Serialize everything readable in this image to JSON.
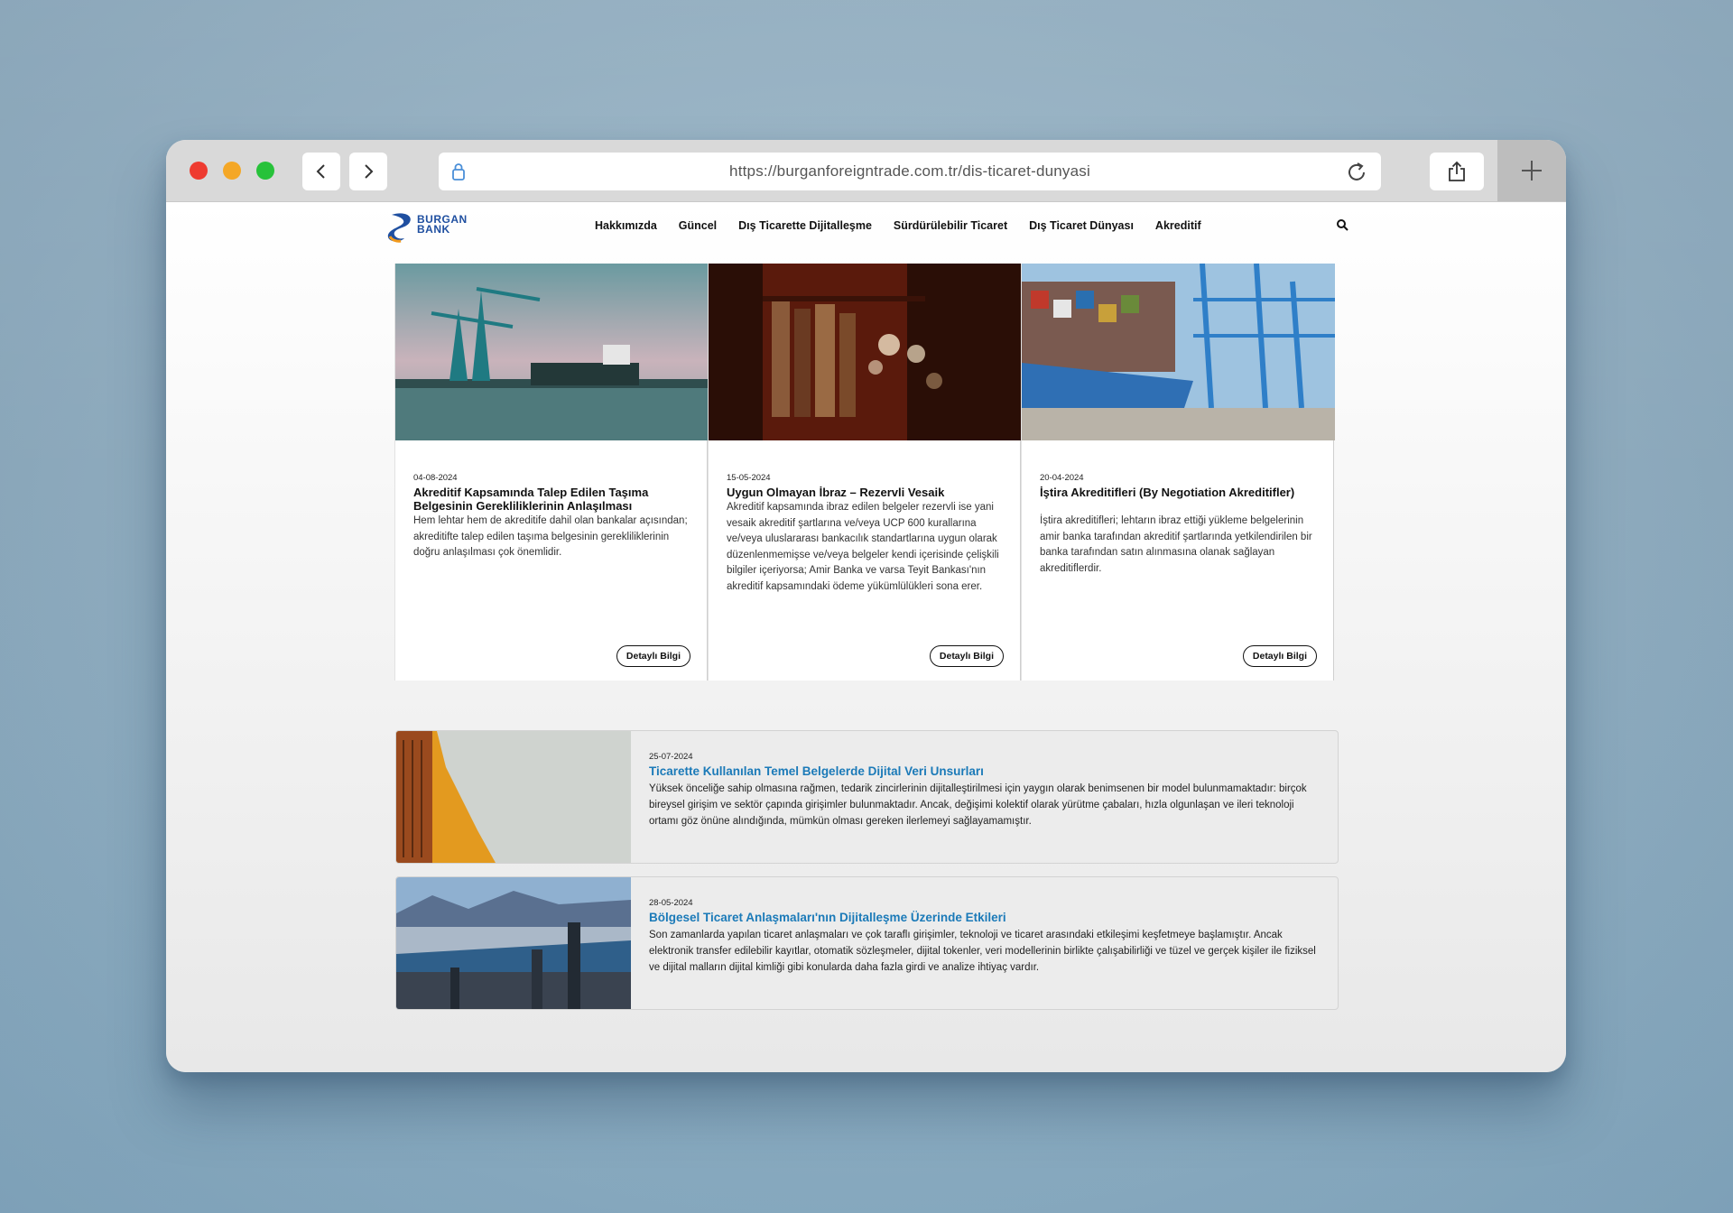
{
  "browser": {
    "url": "https://burganforeigntrade.com.tr/dis-ticaret-dunyasi"
  },
  "header": {
    "logo_line1": "BURGAN",
    "logo_line2": "BANK",
    "nav": [
      "Hakkımızda",
      "Güncel",
      "Dış Ticarette Dijitalleşme",
      "Sürdürülebilir Ticaret",
      "Dış Ticaret Dünyası",
      "Akreditif"
    ]
  },
  "cards": [
    {
      "date": "04-08-2024",
      "title": "Akreditif Kapsamında Talep Edilen Taşıma Belgesinin Gerekliliklerinin Anlaşılması",
      "desc": "Hem lehtar hem de akreditife dahil olan bankalar açısından; akreditifte talep edilen taşıma belgesinin gerekliliklerinin doğru anlaşılması çok önemlidir.",
      "button": "Detaylı Bilgi"
    },
    {
      "date": "15-05-2024",
      "title": "Uygun Olmayan İbraz – Rezervli Vesaik",
      "desc": "Akreditif kapsamında ibraz edilen belgeler rezervli ise yani vesaik akreditif şartlarına ve/veya UCP 600 kurallarına ve/veya uluslararası bankacılık standartlarına uygun olarak düzenlenmemişse ve/veya belgeler kendi içerisinde çelişkili bilgiler içeriyorsa; Amir Banka ve varsa Teyit Bankası'nın akreditif kapsamındaki ödeme yükümlülükleri sona erer.",
      "button": "Detaylı Bilgi"
    },
    {
      "date": "20-04-2024",
      "title": "İştira Akreditifleri (By Negotiation Akreditifler)",
      "desc": "İştira akreditifleri; lehtarın ibraz ettiği yükleme belgelerinin amir banka tarafından akreditif şartlarında yetkilendirilen bir banka tarafından satın alınmasına olanak sağlayan akreditiflerdir.",
      "button": "Detaylı Bilgi"
    }
  ],
  "list": [
    {
      "date": "25-07-2024",
      "title": "Ticarette Kullanılan Temel Belgelerde Dijital Veri Unsurları",
      "desc": "Yüksek önceliğe sahip olmasına rağmen, tedarik zincirlerinin dijitalleştirilmesi için yaygın olarak benimsenen bir model bulunmamaktadır: birçok bireysel girişim ve sektör çapında girişimler bulunmaktadır. Ancak, değişimi kolektif olarak yürütme çabaları, hızla olgunlaşan ve ileri teknoloji ortamı göz önüne alındığında, mümkün olması gereken ilerlemeyi sağlayamamıştır."
    },
    {
      "date": "28-05-2024",
      "title": "Bölgesel Ticaret Anlaşmaları'nın Dijitalleşme Üzerinde Etkileri",
      "desc": "Son zamanlarda yapılan ticaret anlaşmaları ve çok taraflı girişimler, teknoloji ve ticaret arasındaki etkileşimi keşfetmeye başlamıştır. Ancak elektronik transfer edilebilir kayıtlar, otomatik sözleşmeler, dijital tokenler, veri modellerinin birlikte çalışabilirliği ve tüzel ve gerçek kişiler ile fiziksel ve dijital malların dijital kimliği gibi konularda daha fazla girdi ve analize ihtiyaç vardır."
    }
  ]
}
